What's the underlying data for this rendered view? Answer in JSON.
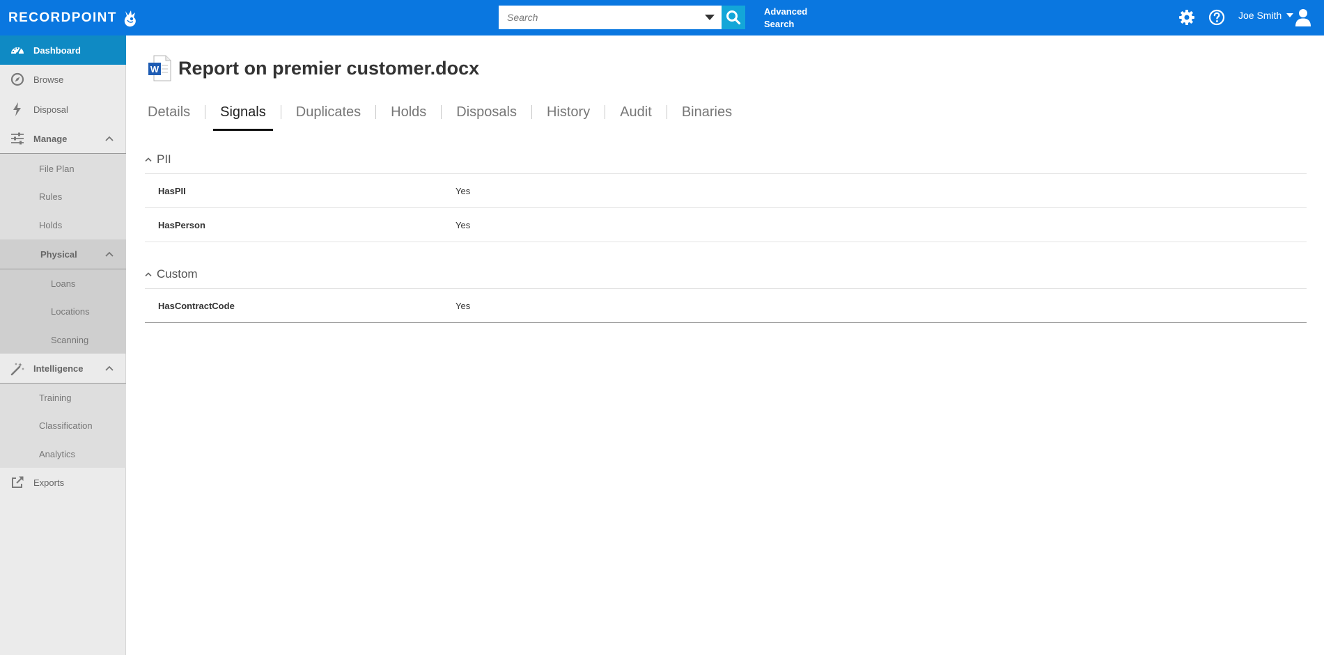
{
  "header": {
    "logo_text": "RECORDPOINT",
    "search": {
      "placeholder": "Search",
      "value": ""
    },
    "advanced_search_line1": "Advanced",
    "advanced_search_line2": "Search",
    "user_name": "Joe Smith"
  },
  "sidebar": {
    "dashboard": "Dashboard",
    "browse": "Browse",
    "disposal": "Disposal",
    "manage": "Manage",
    "file_plan": "File Plan",
    "rules": "Rules",
    "holds": "Holds",
    "physical": "Physical",
    "loans": "Loans",
    "locations": "Locations",
    "scanning": "Scanning",
    "intelligence": "Intelligence",
    "training": "Training",
    "classification": "Classification",
    "analytics": "Analytics",
    "exports": "Exports"
  },
  "main": {
    "title": "Report on premier customer.docx",
    "doc_icon_letter": "W",
    "tabs": [
      "Details",
      "Signals",
      "Duplicates",
      "Holds",
      "Disposals",
      "History",
      "Audit",
      "Binaries"
    ],
    "active_tab": "Signals",
    "sections": [
      {
        "title": "PII",
        "rows": [
          {
            "name": "HasPII",
            "value": "Yes"
          },
          {
            "name": "HasPerson",
            "value": "Yes"
          }
        ]
      },
      {
        "title": "Custom",
        "rows": [
          {
            "name": "HasContractCode",
            "value": "Yes"
          }
        ]
      }
    ]
  },
  "colors": {
    "topbar": "#0a77e0",
    "active_nav": "#0f8ac4",
    "search_button": "#13a6d8"
  }
}
